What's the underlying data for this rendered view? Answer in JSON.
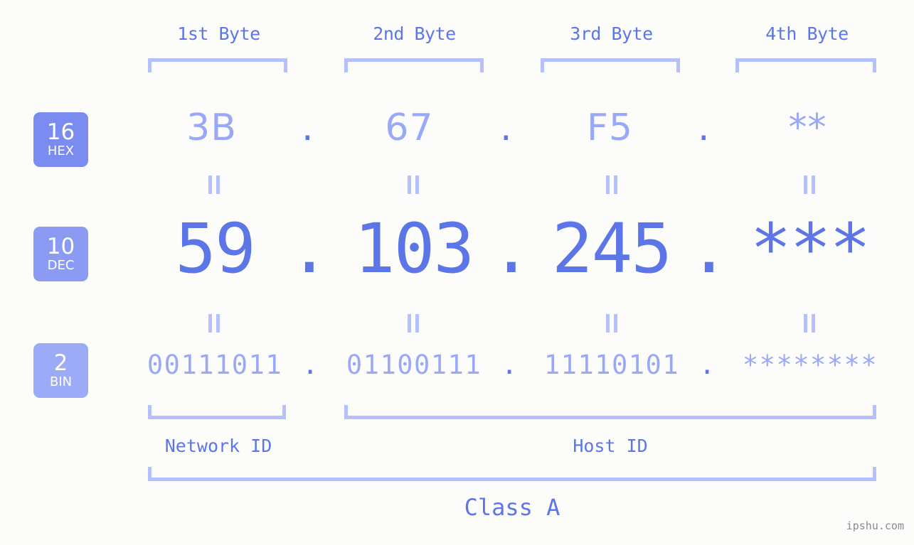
{
  "title": "IP Address Byte Breakdown",
  "colors": {
    "background": "#fcfdfa",
    "accent_strong": "#5c76e8",
    "accent_light": "#9aa9f7",
    "bracket": "#b6c0fb",
    "badge_hex": "#7b8cf0",
    "badge_dec": "#8b9bf4",
    "badge_bin": "#9cabf7",
    "watermark": "#8b8b8b"
  },
  "header": {
    "bytes": [
      {
        "label": "1st Byte"
      },
      {
        "label": "2nd Byte"
      },
      {
        "label": "3rd Byte"
      },
      {
        "label": "4th Byte"
      }
    ]
  },
  "bases": [
    {
      "number": "16",
      "name": "HEX"
    },
    {
      "number": "10",
      "name": "DEC"
    },
    {
      "number": "2",
      "name": "BIN"
    }
  ],
  "rows": {
    "hex": {
      "base_number": "16",
      "base_name": "HEX",
      "values": [
        "3B",
        "67",
        "F5",
        "**"
      ],
      "separator": "."
    },
    "dec": {
      "base_number": "10",
      "base_name": "DEC",
      "values": [
        "59",
        "103",
        "245",
        "***"
      ],
      "separator": "."
    },
    "bin": {
      "base_number": "2",
      "base_name": "BIN",
      "values": [
        "00111011",
        "01100111",
        "11110101",
        "********"
      ],
      "separator": "."
    }
  },
  "connectors": {
    "symbol": "="
  },
  "footer": {
    "network_id_label": "Network ID",
    "host_id_label": "Host ID",
    "class_label": "Class A",
    "watermark": "ipshu.com"
  }
}
